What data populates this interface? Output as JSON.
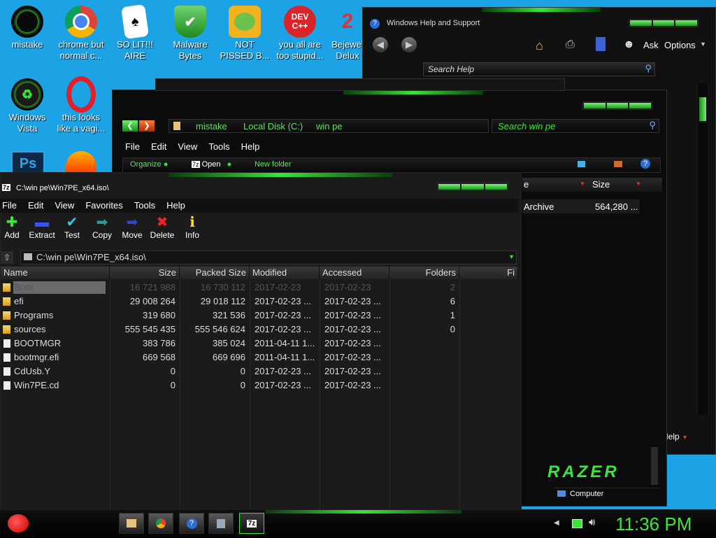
{
  "colors": {
    "desktop": "#1ba3e6",
    "accent": "#39e639",
    "window_bg": "#111111",
    "text_dim": "#999999"
  },
  "desktop_icons": [
    {
      "label": "mistake",
      "icon": "razer-icon"
    },
    {
      "label": "chrome but normal c...",
      "icon": "chrome-icon"
    },
    {
      "label": "SO LIT!!! AIRE",
      "icon": "solitaire-icon"
    },
    {
      "label": "Malware Bytes",
      "icon": "malwarebytes-icon"
    },
    {
      "label": "NOT PISSED B...",
      "icon": "angry-birds-icon"
    },
    {
      "label": "you all are too stupid...",
      "icon": "devcpp-icon"
    },
    {
      "label": "Bejewel Delux",
      "icon": "bejeweled-icon"
    },
    {
      "label": "Windows Vista",
      "icon": "recycle-icon"
    },
    {
      "label": "this looks like a vagi...",
      "icon": "opera-icon"
    }
  ],
  "devcpp_text": "DEV C++",
  "help_window": {
    "title": "Windows Help and Support",
    "ask": "Ask",
    "options": "Options",
    "search_placeholder": "Search Help",
    "footer": "Help"
  },
  "explorer": {
    "breadcrumb": [
      "mistake",
      "Local Disk (C:)",
      "win pe"
    ],
    "search_placeholder": "Search win pe",
    "menu": [
      "File",
      "Edit",
      "View",
      "Tools",
      "Help"
    ],
    "toolbar": {
      "organize": "Organize",
      "open": "Open",
      "new_folder": "New folder"
    },
    "col_size": "Size",
    "item_name": "Archive",
    "item_size": "564,280 ...",
    "logo": "RAZER",
    "status": "Computer"
  },
  "sevenzip": {
    "title": "C:\\win pe\\Win7PE_x64.iso\\",
    "menu": [
      "File",
      "Edit",
      "View",
      "Favorites",
      "Tools",
      "Help"
    ],
    "toolbar": [
      {
        "label": "Add",
        "icon": "add-icon",
        "glyph": "✚",
        "color": "#39e639"
      },
      {
        "label": "Extract",
        "icon": "extract-icon",
        "glyph": "▬",
        "color": "#3355ff"
      },
      {
        "label": "Test",
        "icon": "test-icon",
        "glyph": "✔",
        "color": "#33ccdd"
      },
      {
        "label": "Copy",
        "icon": "copy-icon",
        "glyph": "➡",
        "color": "#2a9a9a"
      },
      {
        "label": "Move",
        "icon": "move-icon",
        "glyph": "➡",
        "color": "#3344cc"
      },
      {
        "label": "Delete",
        "icon": "delete-icon",
        "glyph": "✖",
        "color": "#ee2222"
      },
      {
        "label": "Info",
        "icon": "info-icon",
        "glyph": "ℹ",
        "color": "#ffdd33"
      }
    ],
    "path": "C:\\win pe\\Win7PE_x64.iso\\",
    "columns": [
      "Name",
      "Size",
      "Packed Size",
      "Modified",
      "Accessed",
      "Folders",
      "Fi"
    ],
    "rows": [
      {
        "name": "Boot",
        "size": "16 721 988",
        "packed": "16 730 112",
        "modified": "2017-02-23",
        "accessed": "2017-02-23",
        "folders": "2",
        "type": "folder"
      },
      {
        "name": "efi",
        "size": "29 008 264",
        "packed": "29 018 112",
        "modified": "2017-02-23 ...",
        "accessed": "2017-02-23 ...",
        "folders": "6",
        "type": "folder"
      },
      {
        "name": "Programs",
        "size": "319 680",
        "packed": "321 536",
        "modified": "2017-02-23 ...",
        "accessed": "2017-02-23 ...",
        "folders": "1",
        "type": "folder"
      },
      {
        "name": "sources",
        "size": "555 545 435",
        "packed": "555 546 624",
        "modified": "2017-02-23 ...",
        "accessed": "2017-02-23 ...",
        "folders": "0",
        "type": "folder"
      },
      {
        "name": "BOOTMGR",
        "size": "383 786",
        "packed": "385 024",
        "modified": "2011-04-11 1...",
        "accessed": "2017-02-23 ...",
        "folders": "",
        "type": "file"
      },
      {
        "name": "bootmgr.efi",
        "size": "669 568",
        "packed": "669 696",
        "modified": "2011-04-11 1...",
        "accessed": "2017-02-23 ...",
        "folders": "",
        "type": "file"
      },
      {
        "name": "CdUsb.Y",
        "size": "0",
        "packed": "0",
        "modified": "2017-02-23 ...",
        "accessed": "2017-02-23 ...",
        "folders": "",
        "type": "file"
      },
      {
        "name": "Win7PE.cd",
        "size": "0",
        "packed": "0",
        "modified": "2017-02-23 ...",
        "accessed": "2017-02-23 ...",
        "folders": "",
        "type": "file"
      }
    ]
  },
  "taskbar": {
    "clock": "11:36 PM",
    "sevenzip_label": "7z",
    "apps": [
      "explorer-icon",
      "chrome-icon",
      "help-icon",
      "devices-icon",
      "sevenzip-icon"
    ]
  }
}
